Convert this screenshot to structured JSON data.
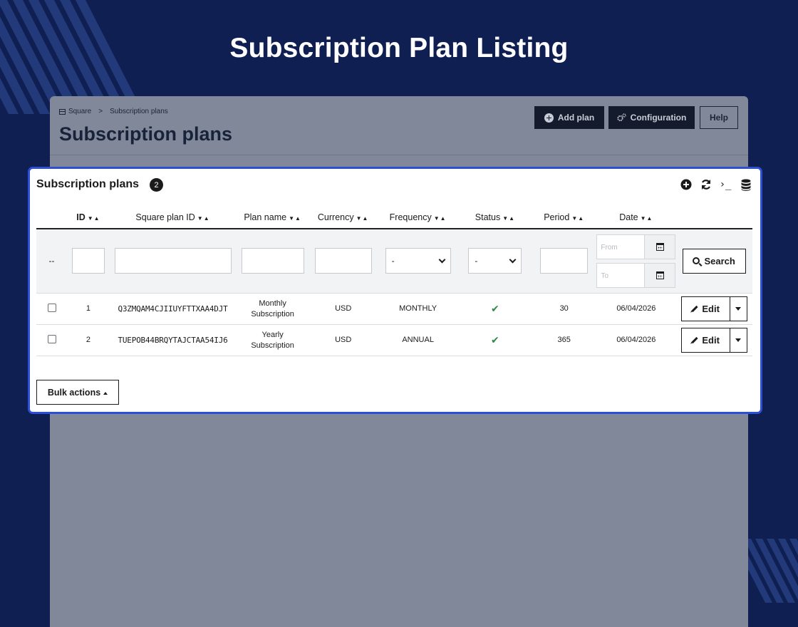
{
  "page": {
    "heading": "Subscription Plan Listing"
  },
  "colors": {
    "background": "#101f52",
    "card_border": "#2d4fd6",
    "status_ok": "#2f8a4a"
  },
  "backdrop": {
    "breadcrumb": {
      "store": "Square",
      "separator": ">",
      "current": "Subscription plans"
    },
    "title": "Subscription plans",
    "buttons": {
      "add_plan": "Add plan",
      "configuration": "Configuration",
      "help": "Help"
    }
  },
  "card": {
    "title": "Subscription plans",
    "count": "2",
    "tools": {
      "add": "plus-circle-icon",
      "refresh": "refresh-icon",
      "terminal": "›_",
      "database": "database-icon"
    }
  },
  "table": {
    "columns": [
      "ID",
      "Square plan ID",
      "Plan name",
      "Currency",
      "Frequency",
      "Status",
      "Period",
      "Date"
    ],
    "sort_glyph": "▼▲",
    "filters": {
      "id_placeholder": "--",
      "currency_select": "-",
      "status_select": "-",
      "date_from": "From",
      "date_to": "To",
      "search_label": "Search"
    },
    "rows": [
      {
        "id": "1",
        "square_plan_id": "Q3ZMQAM4CJIIUYFTTXAA4DJT",
        "plan_name_line1": "Monthly",
        "plan_name_line2": "Subscription",
        "currency": "USD",
        "frequency": "MONTHLY",
        "status": "✔",
        "period": "30",
        "date": "06/04/2026",
        "edit": "Edit"
      },
      {
        "id": "2",
        "square_plan_id": "TUEPOB44BRQYTAJCTAA54IJ6",
        "plan_name_line1": "Yearly",
        "plan_name_line2": "Subscription",
        "currency": "USD",
        "frequency": "ANNUAL",
        "status": "✔",
        "period": "365",
        "date": "06/04/2026",
        "edit": "Edit"
      }
    ]
  },
  "bulk_actions": "Bulk actions"
}
